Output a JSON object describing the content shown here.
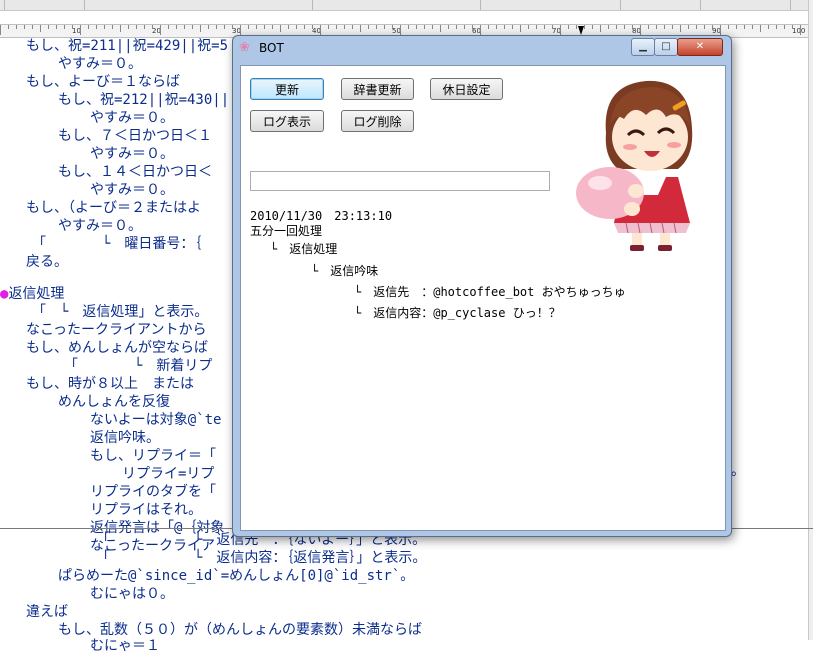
{
  "window": {
    "title": "BOT",
    "buttons": {
      "refresh": "更新",
      "dict_refresh": "辞書更新",
      "holiday": "休日設定",
      "log_view": "ログ表示",
      "log_delete": "ログ削除"
    },
    "input_value": "",
    "log": {
      "timestamp": "2010/11/30　23:13:10",
      "line1": "五分一回処理",
      "line2": "└　返信処理",
      "line3": "└　返信吟味",
      "line4": "└　返信先　：@hotcoffee_bot おやちゅっちゅ",
      "line5": "└　返信内容：@p_cyclase ひっ！？"
    }
  },
  "ruler": {
    "labels": [
      "10",
      "20",
      "30",
      "40",
      "50",
      "60",
      "70",
      "80",
      "90",
      "100"
    ]
  },
  "editor": {
    "lines": [
      {
        "text": "もし、祝=211||祝=429||祝=5"
      },
      {
        "text": "やすみ＝０。"
      },
      {
        "text": "もし、よーび＝１ならば"
      },
      {
        "text": "もし、祝=212||祝=430||"
      },
      {
        "text": "やすみ＝０。"
      },
      {
        "text": "もし、７＜日かつ日＜１"
      },
      {
        "text": "やすみ＝０。"
      },
      {
        "text": "もし、１４＜日かつ日＜"
      },
      {
        "text": "やすみ＝０。"
      },
      {
        "text": "もし、（よーび＝２またはよ"
      },
      {
        "text": "やすみ＝０。"
      },
      {
        "text": "「　　　　└　曜日番号：｛"
      },
      {
        "text": "戻る。"
      },
      {
        "text": "返信処理"
      },
      {
        "text": "「　└　返信処理」と表示。"
      },
      {
        "text": "なこったークライアントから"
      },
      {
        "text": "もし、めんしょんが空ならば"
      },
      {
        "text": "「　　　　└　新着リプ"
      },
      {
        "text": "もし、時が８以上　または"
      },
      {
        "text": "めんしょんを反復"
      },
      {
        "text": "ないよーは対象@`te"
      },
      {
        "text": "返信吟味。"
      },
      {
        "text": "もし、リプライ＝「"
      },
      {
        "text": "リプライ=リプ"
      },
      {
        "text": "リプライのタブを「"
      },
      {
        "text": "リプライはそれ。"
      },
      {
        "text": "返信発言は「@｛対象"
      },
      {
        "text": "なこったークライア"
      },
      {
        "text": "「　　　　　　└　返信先　：｛ないよー｝」と表示。"
      },
      {
        "text": "「　　　　　　└　返信内容：｛返信発言｝」と表示。"
      },
      {
        "text": "ぱらめーた@`since_id`=めんしょん[0]@`id_str`。"
      },
      {
        "text": "むにゃは０。"
      },
      {
        "text": "違えば"
      },
      {
        "text": "もし、乱数（５０）が（めんしょんの要素数）未満ならば"
      },
      {
        "text": "むにゃ＝１"
      }
    ],
    "cut_line_tail": "。"
  }
}
